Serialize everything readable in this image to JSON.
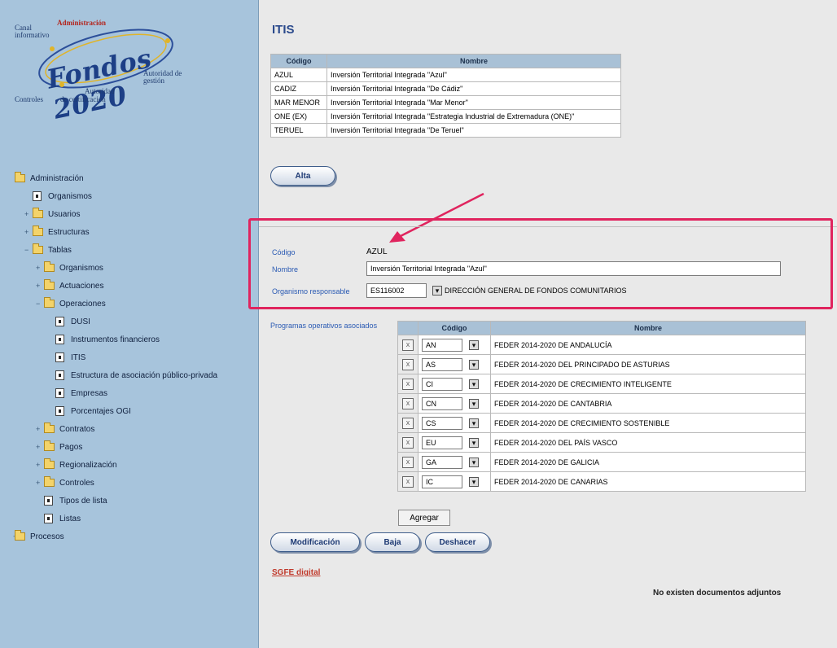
{
  "sidebar": {
    "logo": {
      "admin": "Administración",
      "canal": "Canal informativo",
      "fondos": "Fondos 2020",
      "autoridad_gestion": "Autoridad de gestión",
      "autoridad": "Autoridad",
      "controles": "Controles",
      "certificacion": "de certificación"
    },
    "tree": [
      {
        "label": "Administración",
        "indent": 0,
        "icon": "folder-icon",
        "expander": ""
      },
      {
        "label": "Organismos",
        "indent": 1,
        "icon": "doc-icon",
        "expander": ""
      },
      {
        "label": "Usuarios",
        "indent": 1,
        "icon": "folder-icon",
        "expander": "+"
      },
      {
        "label": "Estructuras",
        "indent": 1,
        "icon": "folder-icon",
        "expander": "+"
      },
      {
        "label": "Tablas",
        "indent": 1,
        "icon": "folder-icon",
        "expander": "−"
      },
      {
        "label": "Organismos",
        "indent": 2,
        "icon": "folder-icon",
        "expander": "+"
      },
      {
        "label": "Actuaciones",
        "indent": 2,
        "icon": "folder-icon",
        "expander": "+"
      },
      {
        "label": "Operaciones",
        "indent": 2,
        "icon": "folder-icon",
        "expander": "−"
      },
      {
        "label": "DUSI",
        "indent": 3,
        "icon": "doc-icon",
        "expander": ""
      },
      {
        "label": "Instrumentos financieros",
        "indent": 3,
        "icon": "doc-icon",
        "expander": ""
      },
      {
        "label": "ITIS",
        "indent": 3,
        "icon": "doc-icon",
        "expander": ""
      },
      {
        "label": "Estructura de asociación público-privada",
        "indent": 3,
        "icon": "doc-icon",
        "expander": ""
      },
      {
        "label": "Empresas",
        "indent": 3,
        "icon": "doc-icon",
        "expander": ""
      },
      {
        "label": "Porcentajes OGI",
        "indent": 3,
        "icon": "doc-icon",
        "expander": ""
      },
      {
        "label": "Contratos",
        "indent": 2,
        "icon": "folder-icon",
        "expander": "+"
      },
      {
        "label": "Pagos",
        "indent": 2,
        "icon": "folder-icon",
        "expander": "+"
      },
      {
        "label": "Regionalización",
        "indent": 2,
        "icon": "folder-icon",
        "expander": "+"
      },
      {
        "label": "Controles",
        "indent": 2,
        "icon": "folder-icon",
        "expander": "+"
      },
      {
        "label": "Tipos de lista",
        "indent": 2,
        "icon": "doc-icon",
        "expander": ""
      },
      {
        "label": "Listas",
        "indent": 2,
        "icon": "doc-icon",
        "expander": ""
      },
      {
        "label": "Procesos",
        "indent": 0,
        "icon": "folder-icon",
        "expander": "+"
      }
    ]
  },
  "main": {
    "title": "ITIS",
    "itis_table": {
      "headers": [
        "Código",
        "Nombre"
      ],
      "rows": [
        [
          "AZUL",
          "Inversión Territorial Integrada \"Azul\""
        ],
        [
          "CADIZ",
          "Inversión Territorial Integrada \"De Cádiz\""
        ],
        [
          "MAR MENOR",
          "Inversión Territorial Integrada \"Mar Menor\""
        ],
        [
          "ONE (EX)",
          "Inversión Territorial Integrada \"Estrategia Industrial de Extremadura (ONE)\""
        ],
        [
          "TERUEL",
          "Inversión Territorial Integrada \"De Teruel\""
        ]
      ]
    },
    "alta_label": "Alta",
    "form": {
      "codigo_label": "Código",
      "codigo_value": "AZUL",
      "nombre_label": "Nombre",
      "nombre_value": "Inversión Territorial Integrada \"Azul\"",
      "organismo_label": "Organismo responsable",
      "organismo_code": "ES116002",
      "organismo_name": "DIRECCIÓN GENERAL DE FONDOS COMUNITARIOS"
    },
    "programas_label": "Programas operativos asociados",
    "prog_table": {
      "headers": [
        "Código",
        "Nombre"
      ],
      "rows": [
        {
          "code": "AN",
          "name": "FEDER 2014-2020 DE ANDALUCÍA"
        },
        {
          "code": "AS",
          "name": "FEDER 2014-2020 DEL PRINCIPADO DE ASTURIAS"
        },
        {
          "code": "CI",
          "name": "FEDER 2014-2020 DE CRECIMIENTO INTELIGENTE"
        },
        {
          "code": "CN",
          "name": "FEDER 2014-2020 DE CANTABRIA"
        },
        {
          "code": "CS",
          "name": "FEDER 2014-2020 DE CRECIMIENTO SOSTENIBLE"
        },
        {
          "code": "EU",
          "name": "FEDER 2014-2020 DEL PAÍS VASCO"
        },
        {
          "code": "GA",
          "name": "FEDER 2014-2020 DE GALICIA"
        },
        {
          "code": "IC",
          "name": "FEDER 2014-2020 DE CANARIAS"
        }
      ]
    },
    "agregar_label": "Agregar",
    "modificacion_label": "Modificación",
    "baja_label": "Baja",
    "deshacer_label": "Deshacer",
    "sgfe_link": "SGFE digital",
    "no_docs": "No existen documentos adjuntos",
    "remove_glyph": "x",
    "dropdown_glyph": "▾"
  },
  "colors": {
    "sidebar_bg": "#a7c4dc",
    "main_bg": "#e9e9e9",
    "highlight_box": "#e0245e",
    "table_header": "#a9c1d6",
    "title": "#2b4a8c"
  }
}
